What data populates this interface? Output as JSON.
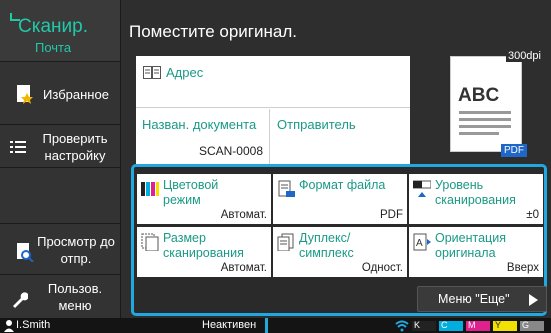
{
  "mode": {
    "title": "Сканир.",
    "subtitle": "Почта"
  },
  "sidebar": {
    "favorites": "Избранное",
    "check_settings": "Проверить настройку",
    "preview": "Просмотр до отпр.",
    "user_menu": "Пользов. меню"
  },
  "main": {
    "prompt": "Поместите оригинал.",
    "address_label": "Адрес",
    "doc_name_label": "Назван. документа",
    "doc_name_value": "SCAN-0008",
    "sender_label": "Отправитель",
    "sender_value": ""
  },
  "preview": {
    "dpi": "300dpi",
    "sample_text": "ABC",
    "format_badge": "PDF"
  },
  "settings": {
    "color_mode_label": "Цветовой режим",
    "color_mode_value": "Автомат.",
    "file_format_label": "Формат файла",
    "file_format_value": "PDF",
    "scan_level_label": "Уровень сканирования",
    "scan_level_value": "±0",
    "scan_size_label": "Размер сканирования",
    "scan_size_value": "Автомат.",
    "duplex_label": "Дуплекс/ симплекс",
    "duplex_value": "Однoст.",
    "orientation_label": "Ориентация оригинала",
    "orientation_value": "Вверх",
    "more_label": "Меню \"Еще\""
  },
  "statusbar": {
    "user": "I.Smith",
    "status": "Неактивен",
    "toner": [
      "K",
      "C",
      "M",
      "Y",
      "G"
    ],
    "toner_colors": [
      "#222222",
      "#00aee0",
      "#e0208c",
      "#f2e000",
      "#888888"
    ]
  }
}
